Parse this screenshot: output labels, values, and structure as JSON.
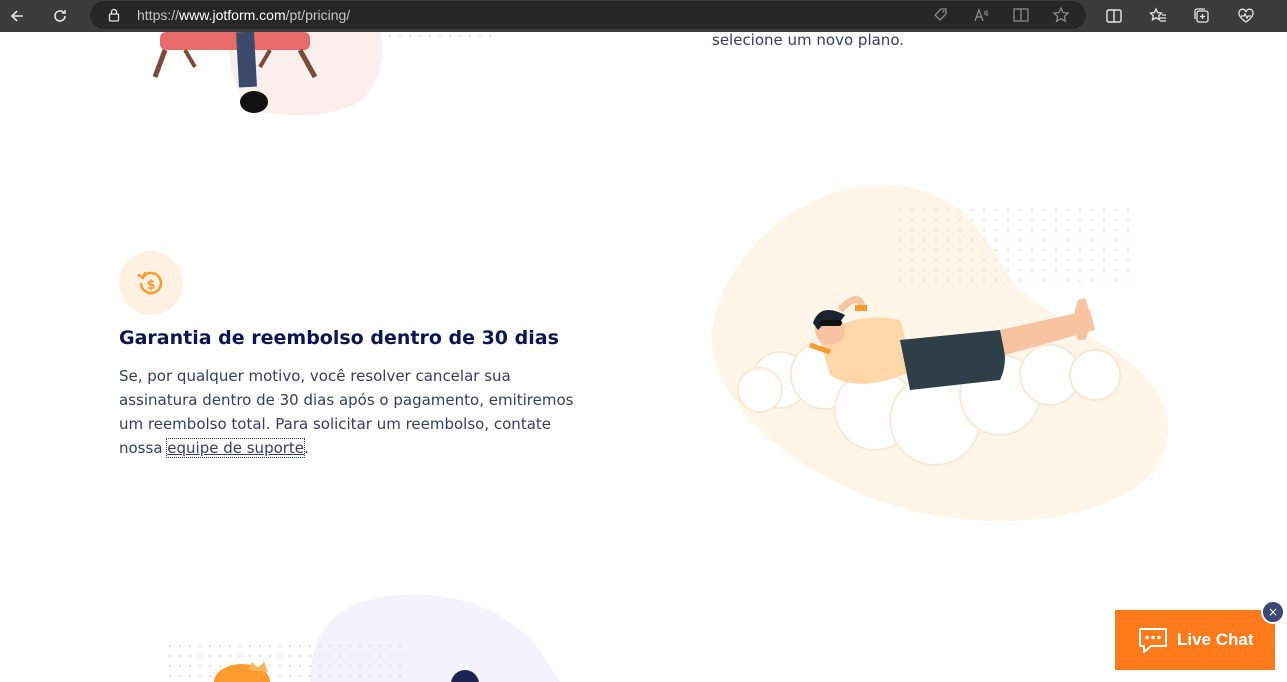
{
  "browser": {
    "url_prefix": "https://",
    "url_host": "www.jotform.com",
    "url_path": "/pt/pricing/"
  },
  "content": {
    "top_snippet": "selecione um novo plano.",
    "refund": {
      "title": "Garantia de reembolso dentro de 30 dias",
      "body": "Se, por qualquer motivo, você resolver cancelar sua assinatura dentro de 30 dias após o pagamento, emitiremos um reembolso total. Para solicitar um reembolso, contate nossa ",
      "link": "equipe de suporte",
      "after_link": "."
    }
  },
  "chat": {
    "label": "Live Chat",
    "close": "×"
  },
  "colors": {
    "accent": "#ff7a1a",
    "heading": "#0a1551",
    "body": "#343c6a"
  }
}
